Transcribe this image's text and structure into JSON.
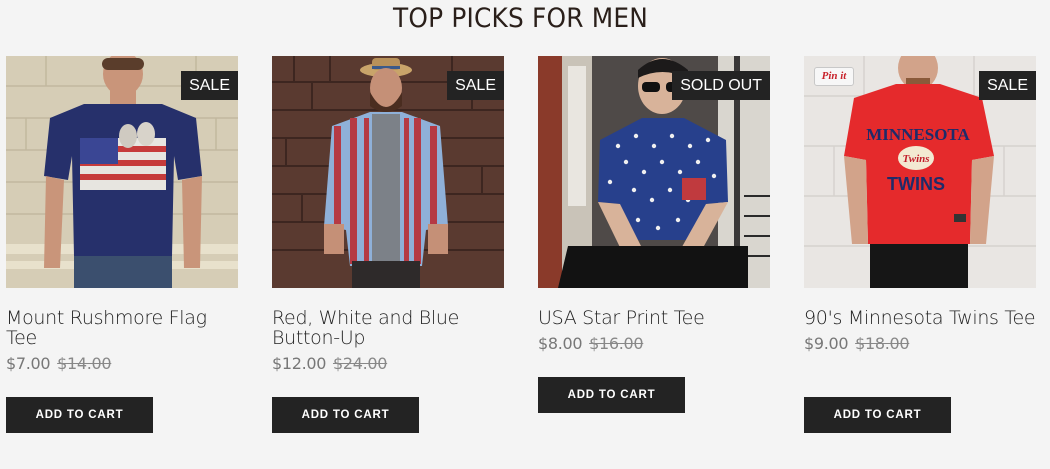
{
  "section": {
    "title": "TOP PICKS FOR MEN"
  },
  "products": [
    {
      "title": "Mount Rushmore Flag Tee",
      "price": "$7.00",
      "compare_price": "$14.00",
      "badge": "SALE",
      "button": "ADD TO CART"
    },
    {
      "title": "Red, White and Blue Button-Up",
      "price": "$12.00",
      "compare_price": "$24.00",
      "badge": "SALE",
      "button": "ADD TO CART"
    },
    {
      "title": "USA Star Print Tee",
      "price": "$8.00",
      "compare_price": "$16.00",
      "badge": "SOLD OUT",
      "button": "ADD TO CART"
    },
    {
      "title": "90's Minnesota Twins Tee",
      "price": "$9.00",
      "compare_price": "$18.00",
      "badge": "SALE",
      "button": "ADD TO CART",
      "pin_label": "Pin it"
    }
  ],
  "icons": {
    "pin": "pinterest-pin-it-icon"
  },
  "colors": {
    "background": "#f4f4f4",
    "badge": "#232323",
    "button": "#232323",
    "title": "#2a1f1a",
    "price": "#777777"
  }
}
